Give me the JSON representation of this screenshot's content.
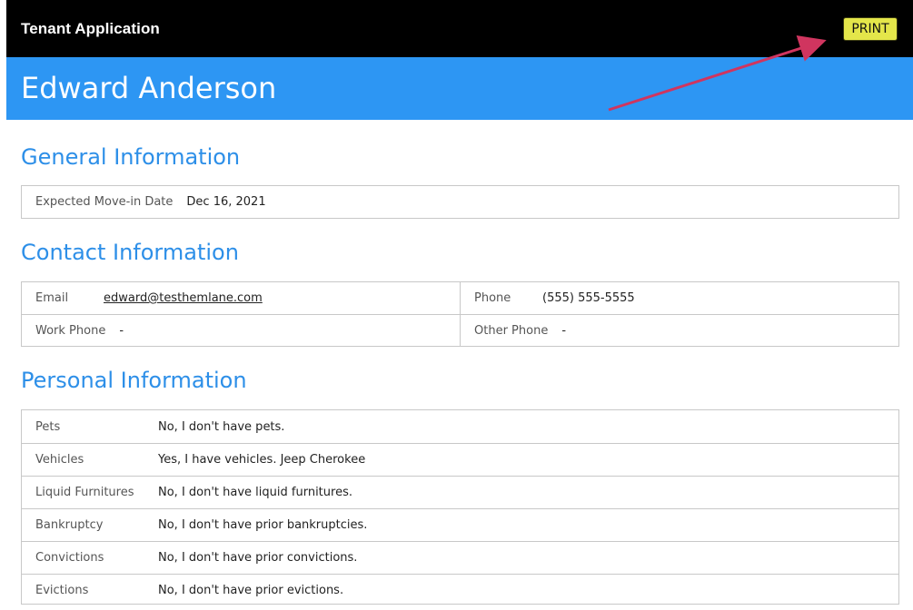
{
  "app": {
    "title": "Tenant Application",
    "print_label": "PRINT"
  },
  "applicant": {
    "name": "Edward Anderson"
  },
  "general": {
    "title": "General Information",
    "move_in_label": "Expected Move-in Date",
    "move_in_value": "Dec 16, 2021"
  },
  "contact": {
    "title": "Contact Information",
    "email_label": "Email",
    "email_value": "edward@testhemlane.com",
    "phone_label": "Phone",
    "phone_value": "(555) 555-5555",
    "work_phone_label": "Work Phone",
    "work_phone_value": "-",
    "other_phone_label": "Other Phone",
    "other_phone_value": "-"
  },
  "personal": {
    "title": "Personal Information",
    "rows": [
      {
        "label": "Pets",
        "value": "No, I don't have pets."
      },
      {
        "label": "Vehicles",
        "value": "Yes, I have vehicles. Jeep Cherokee"
      },
      {
        "label": "Liquid Furnitures",
        "value": "No, I don't have liquid furnitures."
      },
      {
        "label": "Bankruptcy",
        "value": "No, I don't have prior bankruptcies."
      },
      {
        "label": "Convictions",
        "value": "No, I don't have prior convictions."
      },
      {
        "label": "Evictions",
        "value": "No, I don't have prior evictions."
      }
    ]
  },
  "colors": {
    "topbar": "#000000",
    "banner": "#2d96f3",
    "section_title": "#2d8fe8",
    "print_button": "#e4e64a",
    "annotation_arrow": "#d0355f"
  }
}
